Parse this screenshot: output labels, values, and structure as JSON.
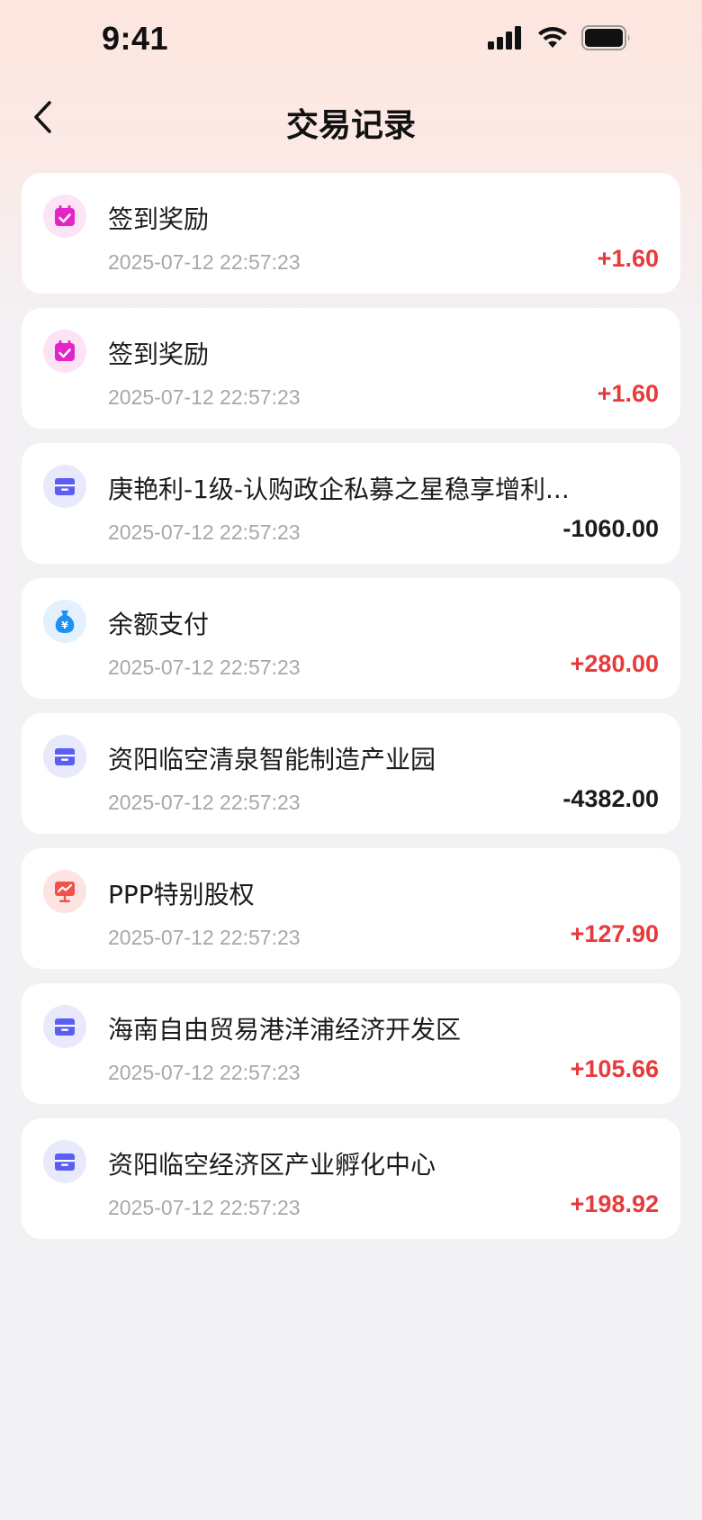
{
  "status_bar": {
    "time": "9:41"
  },
  "header": {
    "title": "交易记录"
  },
  "colors": {
    "positive": "#e8393b",
    "negative": "#1b1b1b",
    "timestamp": "#a8a8a8"
  },
  "transactions": [
    {
      "icon": "calendar-check-icon",
      "title": "签到奖励",
      "time": "2025-07-12 22:57:23",
      "amount": "+1.60",
      "sign": "pos"
    },
    {
      "icon": "calendar-check-icon",
      "title": "签到奖励",
      "time": "2025-07-12 22:57:23",
      "amount": "+1.60",
      "sign": "pos"
    },
    {
      "icon": "store-icon",
      "title": "庚艳利-1级-认购政企私募之星稳享增利...",
      "time": "2025-07-12 22:57:23",
      "amount": "-1060.00",
      "sign": "neg"
    },
    {
      "icon": "money-bag-icon",
      "title": "余额支付",
      "time": "2025-07-12 22:57:23",
      "amount": "+280.00",
      "sign": "pos"
    },
    {
      "icon": "store-icon",
      "title": "资阳临空清泉智能制造产业园",
      "time": "2025-07-12 22:57:23",
      "amount": "-4382.00",
      "sign": "neg"
    },
    {
      "icon": "chart-board-icon",
      "title": "PPP特别股权",
      "time": "2025-07-12 22:57:23",
      "amount": "+127.90",
      "sign": "pos"
    },
    {
      "icon": "store-icon",
      "title": "海南自由贸易港洋浦经济开发区",
      "time": "2025-07-12 22:57:23",
      "amount": "+105.66",
      "sign": "pos"
    },
    {
      "icon": "store-icon",
      "title": "资阳临空经济区产业孵化中心",
      "time": "2025-07-12 22:57:23",
      "amount": "+198.92",
      "sign": "pos"
    }
  ]
}
